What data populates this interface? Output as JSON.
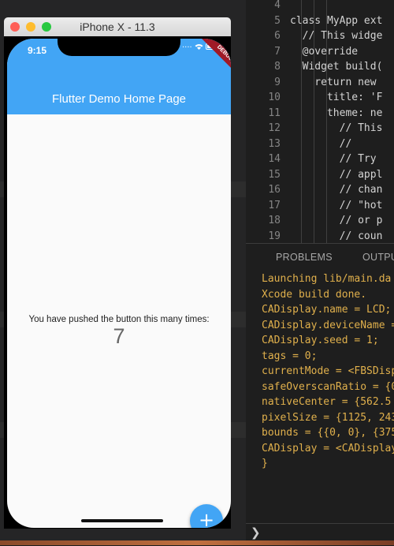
{
  "simulator": {
    "window_title": "iPhone X - 11.3",
    "traffic_light_colors": [
      "#ff5f57",
      "#febc2e",
      "#28c840"
    ],
    "status_time": "9:15",
    "status_icons": [
      "signal-icon",
      "wifi-icon",
      "battery-icon"
    ],
    "debug_banner": "DEBUG",
    "app_title": "Flutter Demo Home Page",
    "counter_label": "You have pushed the button this many times:",
    "counter_value": "7",
    "fab_symbol": "+",
    "colors": {
      "app_bar": "#42a5f5",
      "fab": "#42a5f5",
      "debug_banner": "#a01a27"
    }
  },
  "editor": {
    "lines": [
      {
        "number": "4",
        "code": ""
      },
      {
        "number": "5",
        "code": "class MyApp ext"
      },
      {
        "number": "6",
        "code": "  // This widge"
      },
      {
        "number": "7",
        "code": "  @override"
      },
      {
        "number": "8",
        "code": "  Widget build("
      },
      {
        "number": "9",
        "code": "    return new "
      },
      {
        "number": "10",
        "code": "      title: 'F"
      },
      {
        "number": "11",
        "code": "      theme: ne"
      },
      {
        "number": "12",
        "code": "        // This"
      },
      {
        "number": "13",
        "code": "        //"
      },
      {
        "number": "14",
        "code": "        // Try"
      },
      {
        "number": "15",
        "code": "        // appl"
      },
      {
        "number": "16",
        "code": "        // chan"
      },
      {
        "number": "17",
        "code": "        // \"hot"
      },
      {
        "number": "18",
        "code": "        // or p"
      },
      {
        "number": "19",
        "code": "        // coun"
      }
    ]
  },
  "panel": {
    "tabs": [
      "PROBLEMS",
      "OUTPU"
    ],
    "output": [
      "Launching lib/main.da",
      "Xcode build done.",
      "CADisplay.name = LCD;",
      "CADisplay.deviceName =",
      "CADisplay.seed = 1;",
      "tags = 0;",
      "currentMode = <FBSDisp",
      "safeOverscanRatio = {0",
      "nativeCenter = {562.5",
      "pixelSize = {1125, 243",
      "bounds = {{0, 0}, {375",
      "CADisplay = <CADisplay",
      "}"
    ],
    "terminal_prompt": "❯"
  }
}
